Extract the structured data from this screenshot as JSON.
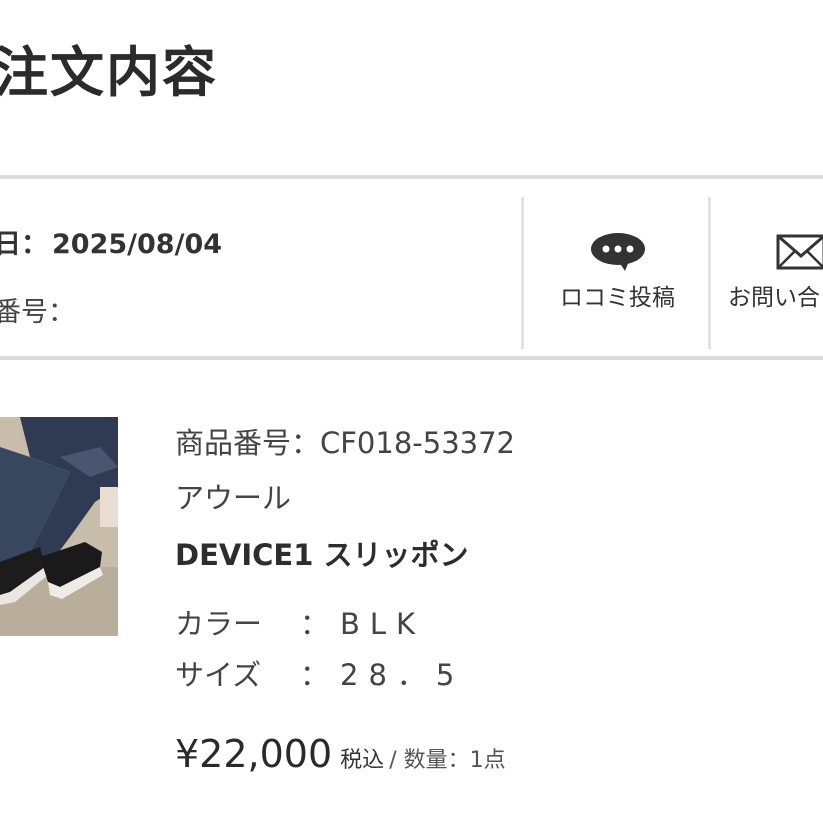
{
  "header": {
    "title": "注文内容"
  },
  "order_info": {
    "date_label": "日：",
    "date_value": "2025/08/04",
    "order_number_label": "番号："
  },
  "actions": {
    "review_label": "ロコミ投稿",
    "inquiry_label": "お問い合"
  },
  "product": {
    "code": "商品番号：CF018-53372",
    "brand": "アウール",
    "name": "DEVICE1 スリッポン",
    "color_label": "カラー",
    "color_separator": "：",
    "color_value": "BLK",
    "size_label": "サイズ",
    "size_separator": "：",
    "size_value": "28．5",
    "price": "¥22,000",
    "tax_label": "税込",
    "quantity": "/ 数量：1点"
  },
  "colors": {
    "divider": "#dcdcdc",
    "text": "#333333",
    "icon": "#333333"
  },
  "icons": {
    "review": "speech-bubble-icon",
    "inquiry": "envelope-icon"
  }
}
